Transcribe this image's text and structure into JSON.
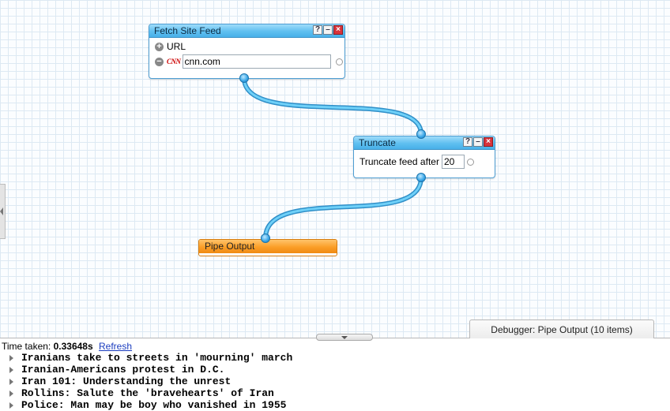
{
  "modules": {
    "fetch_site_feed": {
      "title": "Fetch Site Feed",
      "url_label": "URL",
      "url_value": "cnn.com",
      "site_badge": "CNN"
    },
    "truncate": {
      "title": "Truncate",
      "label": "Truncate feed after",
      "value": "20"
    },
    "pipe_output": {
      "title": "Pipe Output"
    }
  },
  "debugger": {
    "tab_label": "Debugger: Pipe Output (10 items)",
    "time_label": "Time taken:",
    "time_value": "0.33648s",
    "refresh_label": "Refresh",
    "items": [
      "Iranians take to streets in 'mourning' march",
      "Iranian-Americans protest in D.C.",
      "Iran 101: Understanding the unrest",
      "Rollins: Salute the 'bravehearts' of Iran",
      "Police: Man may be boy who vanished in 1955"
    ]
  },
  "colors": {
    "module_header": "#5fbff0",
    "wire": "#48bdf0",
    "pipe_output_header": "#fb9e27",
    "link": "#1a3cbf"
  }
}
